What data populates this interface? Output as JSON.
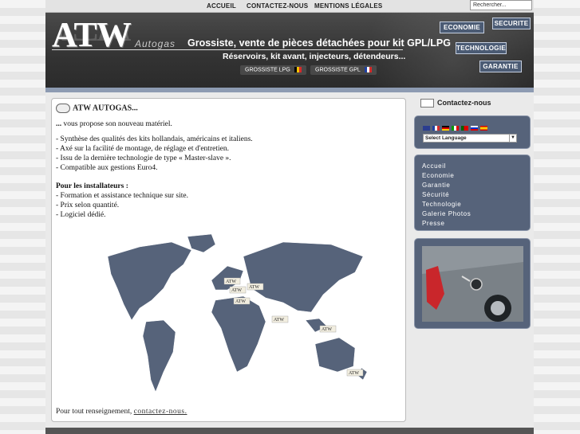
{
  "topnav": {
    "items": [
      "ACCUEIL",
      "CONTACTEZ-NOUS",
      "MENTIONS LÉGALES"
    ],
    "search_placeholder": "Rechercher..."
  },
  "banner": {
    "logo": "ATW",
    "logo_sub": "Autogas",
    "tagline": "Grossiste, vente de pièces détachées pour kit GPL/LPG",
    "tagline2": "Réservoirs, kit avant, injecteurs, détendeurs...",
    "pill_lpg": "GROSSISTE LPG",
    "pill_gpl": "GROSSISTE GPL",
    "buttons": [
      "ECONOMIE",
      "SECURITE",
      "TECHNOLOGIE",
      "GARANTIE"
    ]
  },
  "main": {
    "title": "ATW AUTOGAS...",
    "intro_bold": "...",
    "intro": " vous propose son nouveau matériel.",
    "lines": [
      "- Synthèse des qualités des kits hollandais, américains et italiens.",
      "- Axé sur la facilité de montage, de réglage et d'entretien.",
      "- Issu de la dernière technologie de type « Master-slave ».",
      "- Compatible aux gestions Euro4."
    ],
    "installers_title": "Pour les installateurs :",
    "installers": [
      "- Formation et assistance technique sur site.",
      "- Prix selon quantité.",
      "- Logiciel dédié."
    ],
    "map_marker": "ATW",
    "footer_text": "Pour tout renseignement, ",
    "footer_link": "contactez-nous."
  },
  "sidebar": {
    "contact": "Contactez-nous",
    "language_select": "Select Language",
    "menu": [
      "Accueil",
      "Economie",
      "Garantie",
      "Sécurité",
      "Technologie",
      "Galerie Photos",
      "Presse"
    ]
  },
  "colors": {
    "nav_blue": "#56637a",
    "banner_dark": "#333333"
  }
}
